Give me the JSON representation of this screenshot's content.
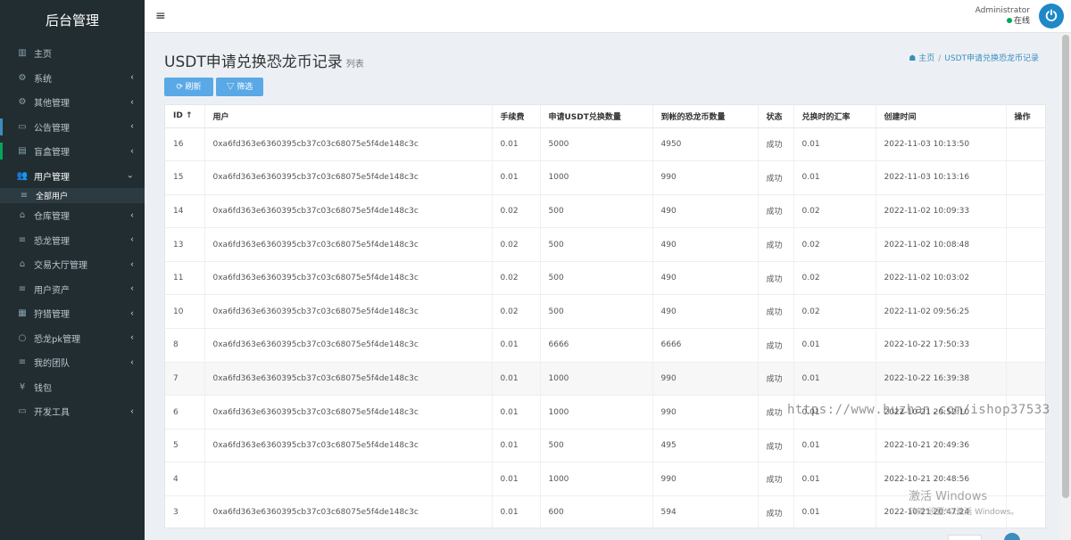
{
  "sidebar": {
    "brand": "后台管理",
    "items": [
      {
        "label": "主页",
        "icon": "▥",
        "arrow": ""
      },
      {
        "label": "系统",
        "icon": "⚙",
        "arrow": "‹"
      },
      {
        "label": "其他管理",
        "icon": "⚙",
        "arrow": "‹"
      },
      {
        "label": "公告管理",
        "icon": "▭",
        "arrow": "‹"
      },
      {
        "label": "盲盒管理",
        "icon": "▤",
        "arrow": "‹"
      },
      {
        "label": "用户管理",
        "icon": "👥",
        "arrow": "⌄"
      }
    ],
    "sub_items": [
      {
        "label": "全部用户",
        "icon": "≡"
      }
    ],
    "items2": [
      {
        "label": "仓库管理",
        "icon": "⌂",
        "arrow": "‹"
      },
      {
        "label": "恐龙管理",
        "icon": "≡",
        "arrow": "‹"
      },
      {
        "label": "交易大厅管理",
        "icon": "⌂",
        "arrow": "‹"
      },
      {
        "label": "用户资产",
        "icon": "≡",
        "arrow": "‹"
      },
      {
        "label": "狩猎管理",
        "icon": "▦",
        "arrow": "‹"
      },
      {
        "label": "恐龙pk管理",
        "icon": "○",
        "arrow": "‹"
      },
      {
        "label": "我的团队",
        "icon": "≡",
        "arrow": "‹"
      },
      {
        "label": "钱包",
        "icon": "¥",
        "arrow": ""
      },
      {
        "label": "开发工具",
        "icon": "▭",
        "arrow": "‹"
      }
    ]
  },
  "header": {
    "menu_icon": "≡",
    "user_name": "Administrator",
    "status": "在线",
    "power_icon": "⏻"
  },
  "page": {
    "title": "USDT申请兑换恐龙币记录",
    "subtitle": "列表",
    "breadcrumb_home": "主页",
    "breadcrumb_current": "USDT申请兑换恐龙币记录",
    "refresh_label": "刷新",
    "filter_label": "筛选"
  },
  "table": {
    "headers": [
      "ID ↑",
      "用户",
      "手续费",
      "申请USDT兑换数量",
      "到帐的恐龙币数量",
      "状态",
      "兑换时的汇率",
      "创建时间",
      "操作"
    ],
    "rows": [
      [
        "16",
        "0xa6fd363e6360395cb37c03c68075e5f4de148c3c",
        "0.01",
        "5000",
        "4950",
        "成功",
        "0.01",
        "2022-11-03 10:13:50",
        ""
      ],
      [
        "15",
        "0xa6fd363e6360395cb37c03c68075e5f4de148c3c",
        "0.01",
        "1000",
        "990",
        "成功",
        "0.01",
        "2022-11-03 10:13:16",
        ""
      ],
      [
        "14",
        "0xa6fd363e6360395cb37c03c68075e5f4de148c3c",
        "0.02",
        "500",
        "490",
        "成功",
        "0.02",
        "2022-11-02 10:09:33",
        ""
      ],
      [
        "13",
        "0xa6fd363e6360395cb37c03c68075e5f4de148c3c",
        "0.02",
        "500",
        "490",
        "成功",
        "0.02",
        "2022-11-02 10:08:48",
        ""
      ],
      [
        "11",
        "0xa6fd363e6360395cb37c03c68075e5f4de148c3c",
        "0.02",
        "500",
        "490",
        "成功",
        "0.02",
        "2022-11-02 10:03:02",
        ""
      ],
      [
        "10",
        "0xa6fd363e6360395cb37c03c68075e5f4de148c3c",
        "0.02",
        "500",
        "490",
        "成功",
        "0.02",
        "2022-11-02 09:56:25",
        ""
      ],
      [
        "8",
        "0xa6fd363e6360395cb37c03c68075e5f4de148c3c",
        "0.01",
        "6666",
        "6666",
        "成功",
        "0.01",
        "2022-10-22 17:50:33",
        ""
      ],
      [
        "7",
        "0xa6fd363e6360395cb37c03c68075e5f4de148c3c",
        "0.01",
        "1000",
        "990",
        "成功",
        "0.01",
        "2022-10-22 16:39:38",
        ""
      ],
      [
        "6",
        "0xa6fd363e6360395cb37c03c68075e5f4de148c3c",
        "0.01",
        "1000",
        "990",
        "成功",
        "0.01",
        "2022-10-21 20:52:10",
        ""
      ],
      [
        "5",
        "0xa6fd363e6360395cb37c03c68075e5f4de148c3c",
        "0.01",
        "500",
        "495",
        "成功",
        "0.01",
        "2022-10-21 20:49:36",
        ""
      ],
      [
        "4",
        "",
        "0.01",
        "1000",
        "990",
        "成功",
        "0.01",
        "2022-10-21 20:48:56",
        ""
      ],
      [
        "3",
        "0xa6fd363e6360395cb37c03c68075e5f4de148c3c",
        "0.01",
        "600",
        "594",
        "成功",
        "0.01",
        "2022-10-21 20:47:24",
        ""
      ]
    ],
    "highlight_row": 7
  },
  "overlay": {
    "watermark": "https://www.huzhan.com/ishop37533",
    "activate_title": "激活 Windows",
    "activate_sub": "转到\"设置\"以激活 Windows。"
  },
  "colors": {
    "sidebar_bg": "#222d32",
    "accent": "#3c8dbc",
    "button": "#5aa9e6"
  }
}
